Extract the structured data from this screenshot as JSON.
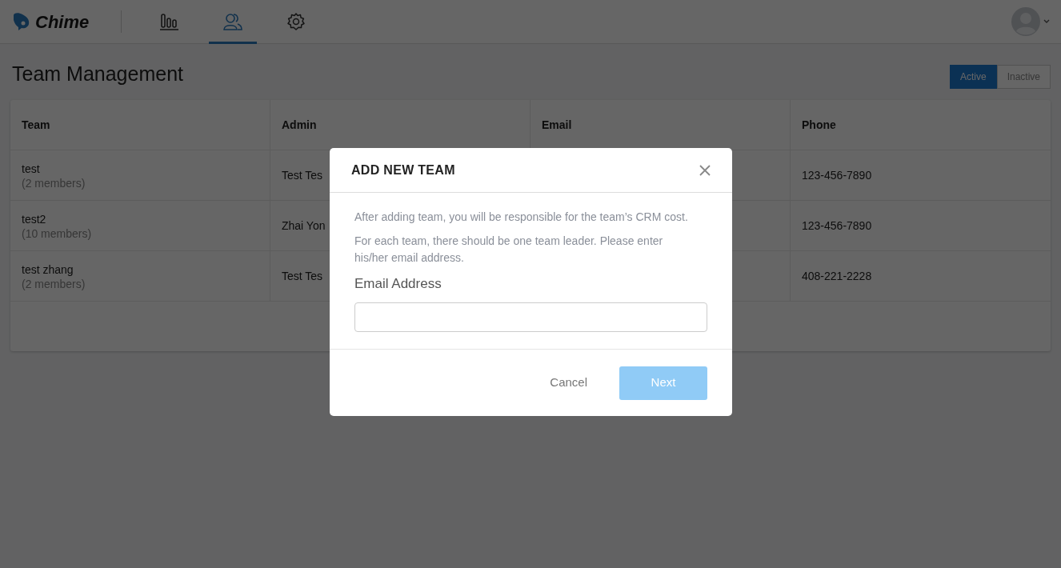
{
  "app": {
    "logo_text": "Chime"
  },
  "nav_tabs": [
    {
      "selected": false
    },
    {
      "selected": true
    },
    {
      "selected": false
    }
  ],
  "page_title": "Team Management",
  "status_filter": [
    {
      "label": "Active",
      "selected": true
    },
    {
      "label": "Inactive",
      "selected": false
    }
  ],
  "table": {
    "columns": [
      "Team",
      "Admin",
      "Email",
      "Phone"
    ],
    "rows": [
      {
        "team": "test",
        "members": "(2 members)",
        "admin": "Test Tes",
        "phone": "123-456-7890"
      },
      {
        "team": "test2",
        "members": "(10 members)",
        "admin": "Zhai Yon",
        "phone": "123-456-7890"
      },
      {
        "team": "test zhang",
        "members": "(2 members)",
        "admin": "Test Tes",
        "phone": "408-221-2228"
      }
    ]
  },
  "modal": {
    "title": "ADD NEW TEAM",
    "paragraphs": [
      "After adding team, you will be responsible for the team’s CRM cost.",
      "For each team, there should be one team leader. Please enter his/her email address."
    ],
    "field_label": "Email Address",
    "buttons": [
      {
        "label": "Cancel",
        "kind": "link",
        "disabled": false
      },
      {
        "label": "Next",
        "kind": "primary",
        "disabled": true
      }
    ]
  }
}
